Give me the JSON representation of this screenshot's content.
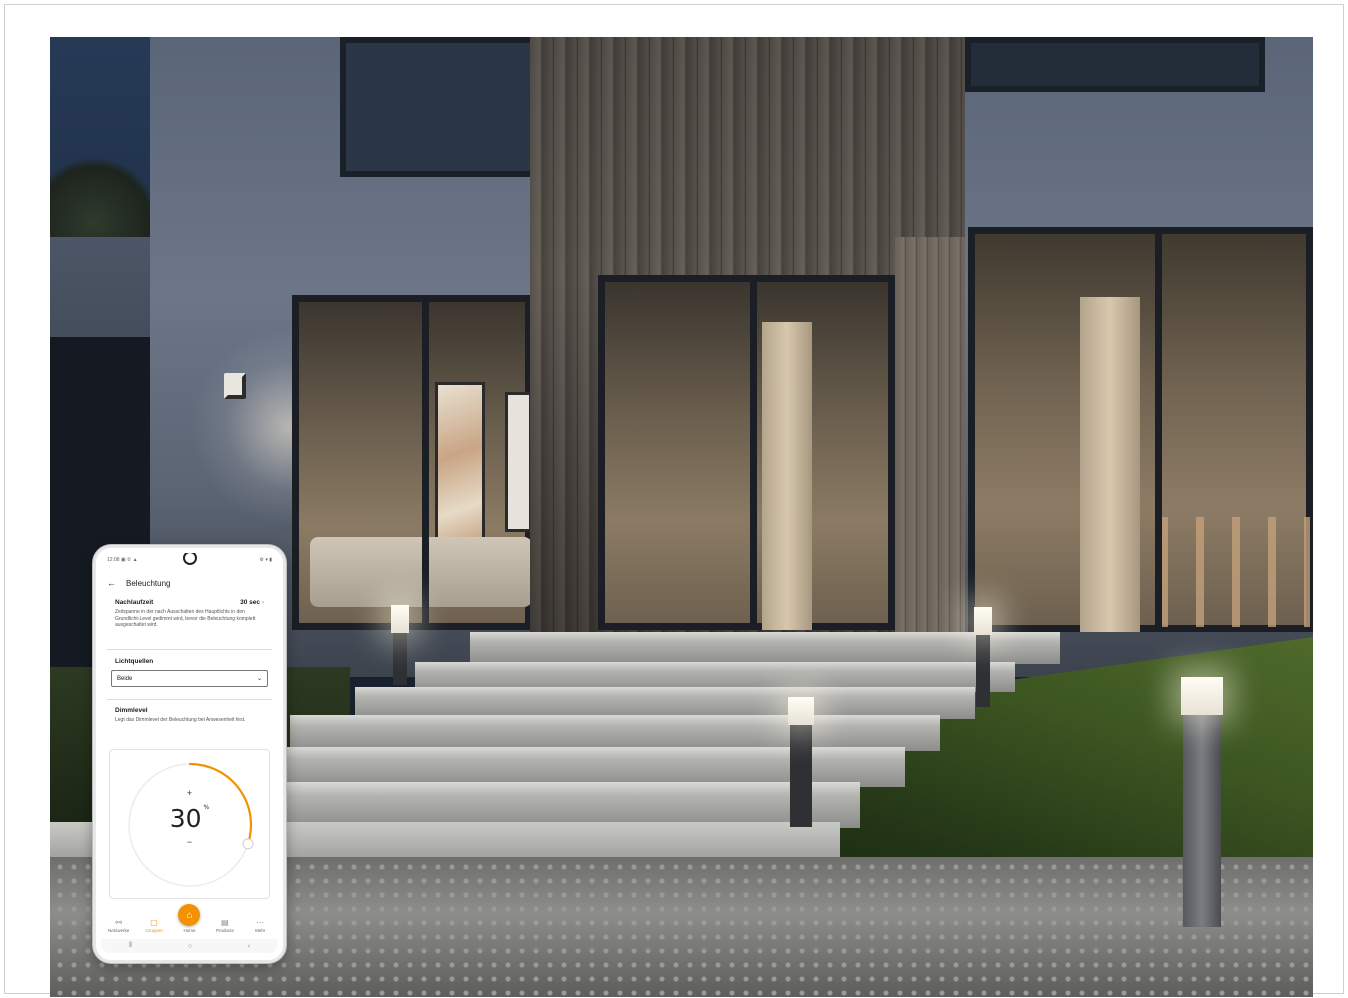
{
  "phone": {
    "status": {
      "time": "12:08",
      "icons_left": "▣ ✆ ▲",
      "icons_right": "⚙ ▾ ▮"
    },
    "appbar": {
      "back_icon": "arrow-left-icon",
      "title": "Beleuchtung"
    },
    "nachlaufzeit": {
      "title": "Nachlaufzeit",
      "value": "30 sec",
      "description": "Zeitspanne in der nach Ausschalten des Hauptlichts in den Grundlicht-Level gedimmt wird, bevor die Beleuchtung komplett ausgeschaltet wird."
    },
    "lichtquellen": {
      "title": "Lichtquellen",
      "selected": "Beide"
    },
    "dimmlevel": {
      "title": "Dimmlevel",
      "description": "Legt das Dimmlevel der Beleuchtung bei Anwesenheit fest.",
      "value": "30",
      "unit": "%",
      "level_percent": 30,
      "plus": "+",
      "minus": "−"
    },
    "tabs": [
      {
        "label": "Netzwerke",
        "icon": "network-icon"
      },
      {
        "label": "Gruppen",
        "icon": "groups-icon",
        "active": true
      },
      {
        "label": "Home",
        "icon": "home-icon"
      },
      {
        "label": "Products",
        "icon": "products-icon"
      },
      {
        "label": "Mehr",
        "icon": "more-icon"
      }
    ],
    "accent_color": "#f39200"
  }
}
